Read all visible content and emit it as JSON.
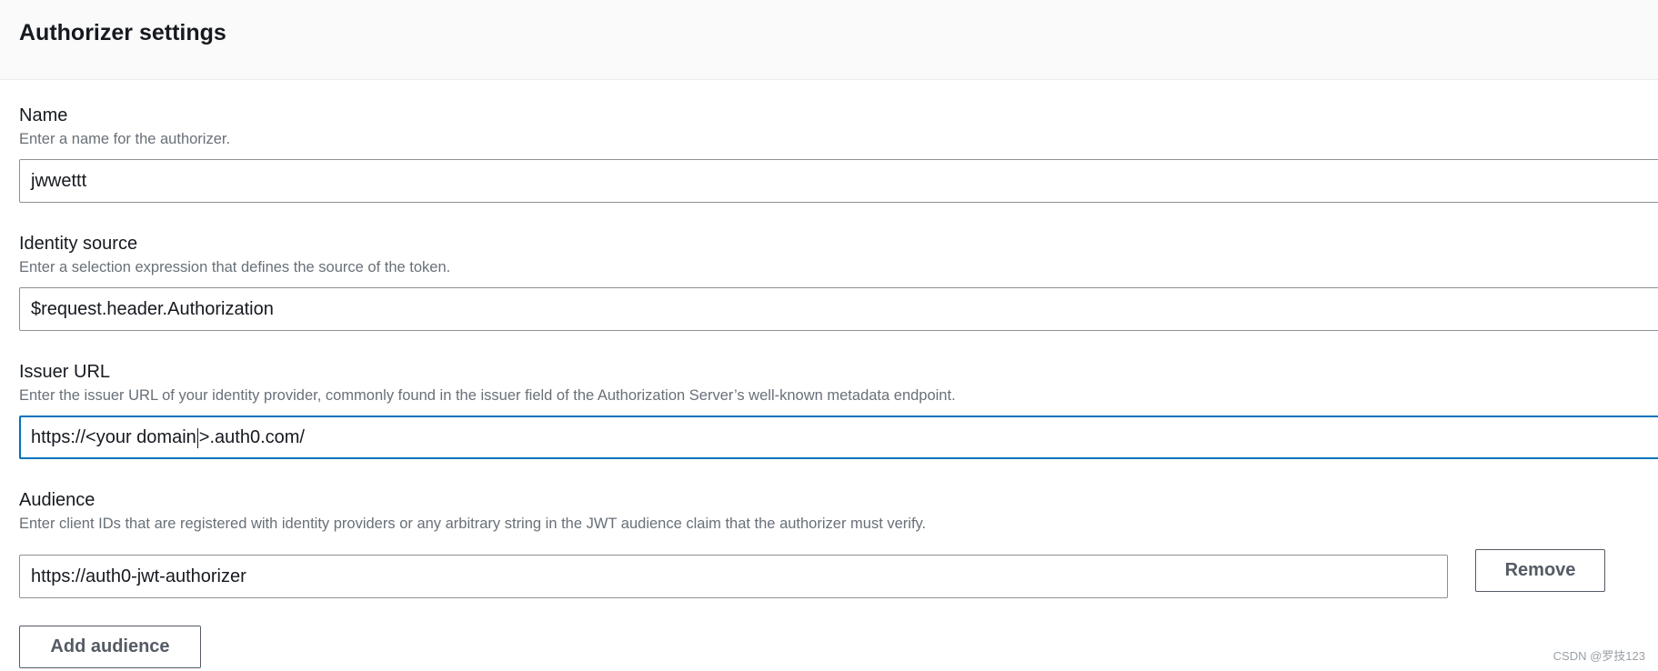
{
  "header": {
    "title": "Authorizer settings"
  },
  "name_field": {
    "label": "Name",
    "description": "Enter a name for the authorizer.",
    "value": "jwwettt"
  },
  "identity_source_field": {
    "label": "Identity source",
    "description": "Enter a selection expression that defines the source of the token.",
    "value": "$request.header.Authorization"
  },
  "issuer_url_field": {
    "label": "Issuer URL",
    "description": "Enter the issuer URL of your identity provider, commonly found in the issuer field of the Authorization Server’s well-known metadata endpoint.",
    "value_before_caret": "https://<your domain",
    "value_after_caret": ">.auth0.com/"
  },
  "audience_field": {
    "label": "Audience",
    "description": "Enter client IDs that are registered with identity providers or any arbitrary string in the JWT audience claim that the authorizer must verify.",
    "value": "https://auth0-jwt-authorizer",
    "remove_label": "Remove",
    "add_label": "Add audience"
  },
  "watermark": {
    "text": "CSDN @罗技123"
  },
  "colors": {
    "focus_border": "#0073bb",
    "input_border": "#8d9096",
    "description_text": "#687078"
  }
}
